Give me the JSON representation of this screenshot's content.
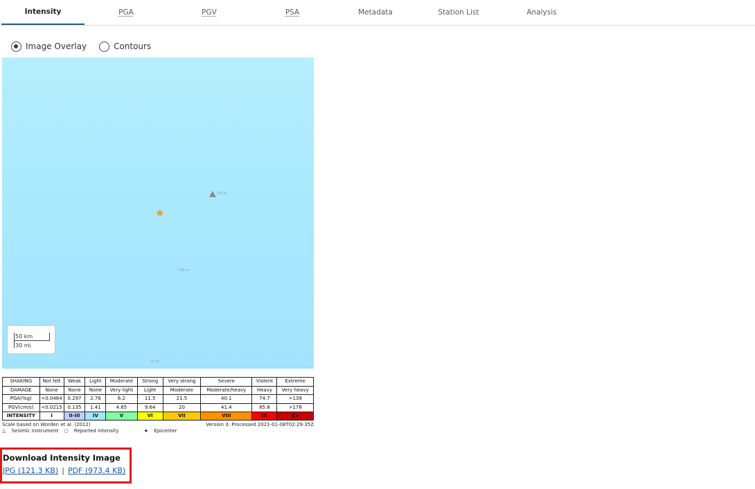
{
  "tabs": [
    {
      "label": "Intensity"
    },
    {
      "label": "PGA"
    },
    {
      "label": "PGV"
    },
    {
      "label": "PSA"
    },
    {
      "label": "Metadata"
    },
    {
      "label": "Station List"
    },
    {
      "label": "Analysis"
    }
  ],
  "active_tab": "Intensity",
  "view_options": {
    "image_overlay": "Image Overlay",
    "contours": "Contours",
    "selected": "Image Overlay"
  },
  "map": {
    "scale_km": "50 km",
    "scale_mi": "30 mi",
    "labels": {
      "top_right": "5/6 m",
      "middle": "236 m",
      "bottom": "70 m"
    },
    "colors": {
      "ocean": "#aae8fd",
      "epicenter": "#f4a21d"
    }
  },
  "legend": {
    "rows": [
      [
        "SHAKING",
        "Not felt",
        "Weak",
        "Light",
        "Moderate",
        "Strong",
        "Very strong",
        "Severe",
        "Violent",
        "Extreme"
      ],
      [
        "DAMAGE",
        "None",
        "None",
        "None",
        "Very light",
        "Light",
        "Moderate",
        "Moderate/heavy",
        "Heavy",
        "Very heavy"
      ],
      [
        "PGA(%g)",
        "<0.0464",
        "0.297",
        "2.76",
        "6.2",
        "11.5",
        "21.5",
        "40.1",
        "74.7",
        ">139"
      ],
      [
        "PGV(cm/s)",
        "<0.0215",
        "0.135",
        "1.41",
        "4.65",
        "9.64",
        "20",
        "41.4",
        "85.8",
        ">178"
      ]
    ],
    "intensity_label": "INTENSITY",
    "intensity": [
      "I",
      "II-III",
      "IV",
      "V",
      "VI",
      "VII",
      "VIII",
      "IX",
      "X+"
    ],
    "intensity_colors": [
      "#ffffff",
      "#bfccff",
      "#a0e6ff",
      "#80ffa0",
      "#ffff00",
      "#ffc800",
      "#ff9100",
      "#ff0000",
      "#c80000"
    ],
    "scale_note": "Scale based on Worden et al. (2012)",
    "version_note": "Version 3: Processed 2021-01-08T02:29:35Z",
    "key_instrument": "Seismic Instrument",
    "key_reported": "Reported Intensity",
    "key_epicenter": "Epicenter"
  },
  "download": {
    "title": "Download Intensity Image",
    "jpg": "JPG (121.3 KB)",
    "pdf": "PDF (973.4 KB)",
    "separator": "|"
  }
}
